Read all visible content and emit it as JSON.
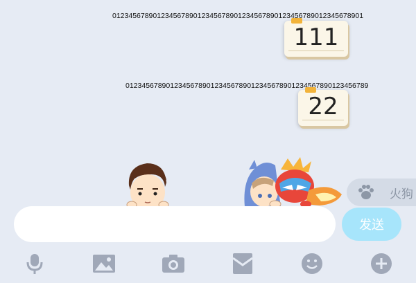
{
  "messages": [
    {
      "header_digits": "01234567890123456789012345678901234567890123456789012345678901",
      "bubble_text": "111"
    },
    {
      "header_digits": "012345678901234567890123456789012345678901234567890123456789",
      "bubble_text": "22"
    }
  ],
  "suggestion": {
    "text": "火狗",
    "icon": "paw-icon"
  },
  "composer": {
    "input_value": "",
    "send_label": "发送"
  },
  "toolbar": [
    {
      "name": "voice",
      "icon": "microphone-icon"
    },
    {
      "name": "image",
      "icon": "image-icon"
    },
    {
      "name": "camera",
      "icon": "camera-icon"
    },
    {
      "name": "red-packet",
      "icon": "red-envelope-icon"
    },
    {
      "name": "emoji",
      "icon": "smiley-icon"
    },
    {
      "name": "more",
      "icon": "plus-icon"
    }
  ],
  "colors": {
    "background": "#e6ebf4",
    "send_button": "#a7e5fb",
    "toolbar_icon": "#a0a8b8",
    "bubble": "#fbf6e8",
    "bubble_tab": "#f2b33a"
  }
}
